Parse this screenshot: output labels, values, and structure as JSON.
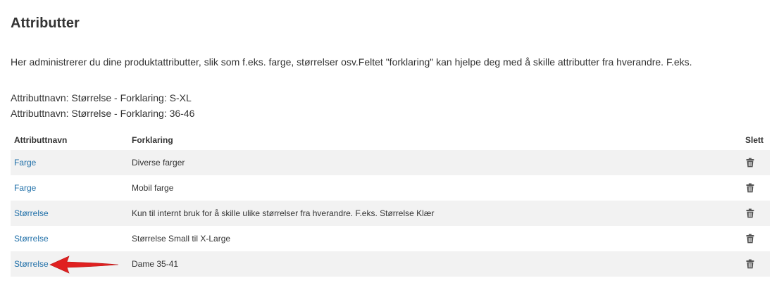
{
  "page": {
    "title": "Attributter",
    "intro": "Her administrerer du dine produktattributter, slik som f.eks. farge, størrelser osv.Feltet \"forklaring\" kan hjelpe deg med å skille attributter fra hverandre. F.eks.",
    "examples": [
      "Attributtnavn: Størrelse - Forklaring: S-XL",
      "Attributtnavn: Størrelse - Forklaring: 36-46"
    ]
  },
  "table": {
    "headers": {
      "name": "Attributtnavn",
      "explanation": "Forklaring",
      "delete": "Slett"
    },
    "rows": [
      {
        "name": "Farge",
        "explanation": "Diverse farger"
      },
      {
        "name": "Farge",
        "explanation": "Mobil farge"
      },
      {
        "name": "Størrelse",
        "explanation": "Kun til internt bruk for å skille ulike størrelser fra hverandre. F.eks. Størrelse Klær"
      },
      {
        "name": "Størrelse",
        "explanation": "Størrelse Small til X-Large"
      },
      {
        "name": "Størrelse",
        "explanation": "Dame 35-41"
      }
    ]
  },
  "icons": {
    "delete": "trash-icon",
    "annotation": "red-arrow-left"
  },
  "colors": {
    "link": "#1f6fa8",
    "row_stripe": "#f2f2f2",
    "annotation_arrow": "#e02020",
    "trash_icon": "#555555"
  }
}
